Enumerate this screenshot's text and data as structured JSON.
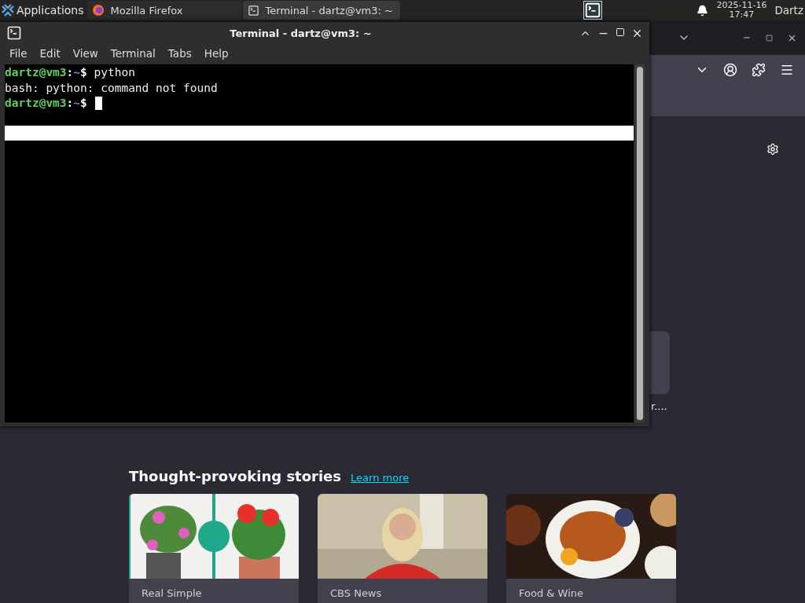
{
  "taskbar": {
    "menu": "Applications",
    "tasks": [
      {
        "label": "Mozilla Firefox",
        "selected": false
      },
      {
        "label": "Terminal - dartz@vm3: ~",
        "selected": true
      }
    ],
    "clock": {
      "date": "2025-11-16",
      "time": "17:47"
    },
    "user": "Dartz"
  },
  "terminal": {
    "title": "Terminal - dartz@vm3: ~",
    "menu": [
      "File",
      "Edit",
      "View",
      "Terminal",
      "Tabs",
      "Help"
    ],
    "lines": [
      {
        "kind": "prompt",
        "user": "dartz@vm3",
        "sep": ":",
        "path": "~",
        "symbol": "$",
        "command": "python"
      },
      {
        "kind": "output",
        "text": "bash: python: command not found"
      },
      {
        "kind": "prompt",
        "user": "dartz@vm3",
        "sep": ":",
        "path": "~",
        "symbol": "$",
        "cursor": true
      }
    ]
  },
  "browser": {
    "shortcut_label": "r....",
    "stories": {
      "heading": "Thought-provoking stories",
      "link": "Learn more",
      "cards": [
        {
          "source": "Real Simple",
          "kind": "picture"
        },
        {
          "source": "CBS News",
          "kind": "picture"
        },
        {
          "source": "Food & Wine",
          "kind": "picture"
        }
      ]
    }
  }
}
